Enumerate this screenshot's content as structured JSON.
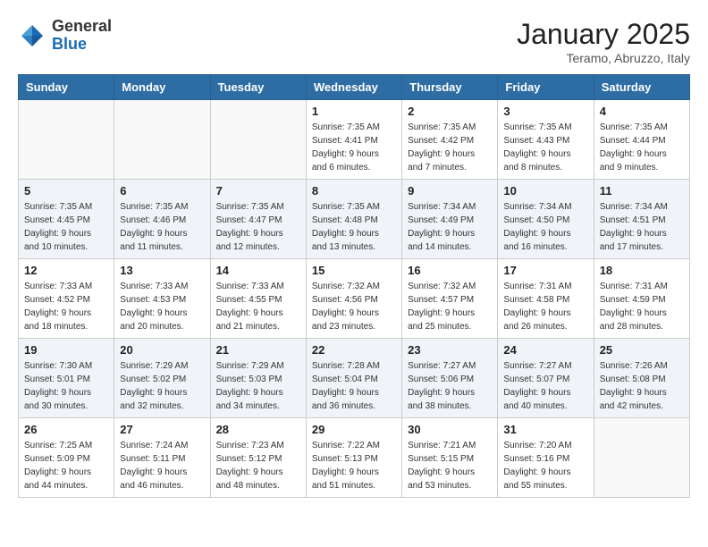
{
  "header": {
    "logo_general": "General",
    "logo_blue": "Blue",
    "month_title": "January 2025",
    "location": "Teramo, Abruzzo, Italy"
  },
  "weekdays": [
    "Sunday",
    "Monday",
    "Tuesday",
    "Wednesday",
    "Thursday",
    "Friday",
    "Saturday"
  ],
  "weeks": [
    [
      {
        "day": "",
        "sunrise": "",
        "sunset": "",
        "daylight": ""
      },
      {
        "day": "",
        "sunrise": "",
        "sunset": "",
        "daylight": ""
      },
      {
        "day": "",
        "sunrise": "",
        "sunset": "",
        "daylight": ""
      },
      {
        "day": "1",
        "sunrise": "Sunrise: 7:35 AM",
        "sunset": "Sunset: 4:41 PM",
        "daylight": "Daylight: 9 hours and 6 minutes."
      },
      {
        "day": "2",
        "sunrise": "Sunrise: 7:35 AM",
        "sunset": "Sunset: 4:42 PM",
        "daylight": "Daylight: 9 hours and 7 minutes."
      },
      {
        "day": "3",
        "sunrise": "Sunrise: 7:35 AM",
        "sunset": "Sunset: 4:43 PM",
        "daylight": "Daylight: 9 hours and 8 minutes."
      },
      {
        "day": "4",
        "sunrise": "Sunrise: 7:35 AM",
        "sunset": "Sunset: 4:44 PM",
        "daylight": "Daylight: 9 hours and 9 minutes."
      }
    ],
    [
      {
        "day": "5",
        "sunrise": "Sunrise: 7:35 AM",
        "sunset": "Sunset: 4:45 PM",
        "daylight": "Daylight: 9 hours and 10 minutes."
      },
      {
        "day": "6",
        "sunrise": "Sunrise: 7:35 AM",
        "sunset": "Sunset: 4:46 PM",
        "daylight": "Daylight: 9 hours and 11 minutes."
      },
      {
        "day": "7",
        "sunrise": "Sunrise: 7:35 AM",
        "sunset": "Sunset: 4:47 PM",
        "daylight": "Daylight: 9 hours and 12 minutes."
      },
      {
        "day": "8",
        "sunrise": "Sunrise: 7:35 AM",
        "sunset": "Sunset: 4:48 PM",
        "daylight": "Daylight: 9 hours and 13 minutes."
      },
      {
        "day": "9",
        "sunrise": "Sunrise: 7:34 AM",
        "sunset": "Sunset: 4:49 PM",
        "daylight": "Daylight: 9 hours and 14 minutes."
      },
      {
        "day": "10",
        "sunrise": "Sunrise: 7:34 AM",
        "sunset": "Sunset: 4:50 PM",
        "daylight": "Daylight: 9 hours and 16 minutes."
      },
      {
        "day": "11",
        "sunrise": "Sunrise: 7:34 AM",
        "sunset": "Sunset: 4:51 PM",
        "daylight": "Daylight: 9 hours and 17 minutes."
      }
    ],
    [
      {
        "day": "12",
        "sunrise": "Sunrise: 7:33 AM",
        "sunset": "Sunset: 4:52 PM",
        "daylight": "Daylight: 9 hours and 18 minutes."
      },
      {
        "day": "13",
        "sunrise": "Sunrise: 7:33 AM",
        "sunset": "Sunset: 4:53 PM",
        "daylight": "Daylight: 9 hours and 20 minutes."
      },
      {
        "day": "14",
        "sunrise": "Sunrise: 7:33 AM",
        "sunset": "Sunset: 4:55 PM",
        "daylight": "Daylight: 9 hours and 21 minutes."
      },
      {
        "day": "15",
        "sunrise": "Sunrise: 7:32 AM",
        "sunset": "Sunset: 4:56 PM",
        "daylight": "Daylight: 9 hours and 23 minutes."
      },
      {
        "day": "16",
        "sunrise": "Sunrise: 7:32 AM",
        "sunset": "Sunset: 4:57 PM",
        "daylight": "Daylight: 9 hours and 25 minutes."
      },
      {
        "day": "17",
        "sunrise": "Sunrise: 7:31 AM",
        "sunset": "Sunset: 4:58 PM",
        "daylight": "Daylight: 9 hours and 26 minutes."
      },
      {
        "day": "18",
        "sunrise": "Sunrise: 7:31 AM",
        "sunset": "Sunset: 4:59 PM",
        "daylight": "Daylight: 9 hours and 28 minutes."
      }
    ],
    [
      {
        "day": "19",
        "sunrise": "Sunrise: 7:30 AM",
        "sunset": "Sunset: 5:01 PM",
        "daylight": "Daylight: 9 hours and 30 minutes."
      },
      {
        "day": "20",
        "sunrise": "Sunrise: 7:29 AM",
        "sunset": "Sunset: 5:02 PM",
        "daylight": "Daylight: 9 hours and 32 minutes."
      },
      {
        "day": "21",
        "sunrise": "Sunrise: 7:29 AM",
        "sunset": "Sunset: 5:03 PM",
        "daylight": "Daylight: 9 hours and 34 minutes."
      },
      {
        "day": "22",
        "sunrise": "Sunrise: 7:28 AM",
        "sunset": "Sunset: 5:04 PM",
        "daylight": "Daylight: 9 hours and 36 minutes."
      },
      {
        "day": "23",
        "sunrise": "Sunrise: 7:27 AM",
        "sunset": "Sunset: 5:06 PM",
        "daylight": "Daylight: 9 hours and 38 minutes."
      },
      {
        "day": "24",
        "sunrise": "Sunrise: 7:27 AM",
        "sunset": "Sunset: 5:07 PM",
        "daylight": "Daylight: 9 hours and 40 minutes."
      },
      {
        "day": "25",
        "sunrise": "Sunrise: 7:26 AM",
        "sunset": "Sunset: 5:08 PM",
        "daylight": "Daylight: 9 hours and 42 minutes."
      }
    ],
    [
      {
        "day": "26",
        "sunrise": "Sunrise: 7:25 AM",
        "sunset": "Sunset: 5:09 PM",
        "daylight": "Daylight: 9 hours and 44 minutes."
      },
      {
        "day": "27",
        "sunrise": "Sunrise: 7:24 AM",
        "sunset": "Sunset: 5:11 PM",
        "daylight": "Daylight: 9 hours and 46 minutes."
      },
      {
        "day": "28",
        "sunrise": "Sunrise: 7:23 AM",
        "sunset": "Sunset: 5:12 PM",
        "daylight": "Daylight: 9 hours and 48 minutes."
      },
      {
        "day": "29",
        "sunrise": "Sunrise: 7:22 AM",
        "sunset": "Sunset: 5:13 PM",
        "daylight": "Daylight: 9 hours and 51 minutes."
      },
      {
        "day": "30",
        "sunrise": "Sunrise: 7:21 AM",
        "sunset": "Sunset: 5:15 PM",
        "daylight": "Daylight: 9 hours and 53 minutes."
      },
      {
        "day": "31",
        "sunrise": "Sunrise: 7:20 AM",
        "sunset": "Sunset: 5:16 PM",
        "daylight": "Daylight: 9 hours and 55 minutes."
      },
      {
        "day": "",
        "sunrise": "",
        "sunset": "",
        "daylight": ""
      }
    ]
  ]
}
